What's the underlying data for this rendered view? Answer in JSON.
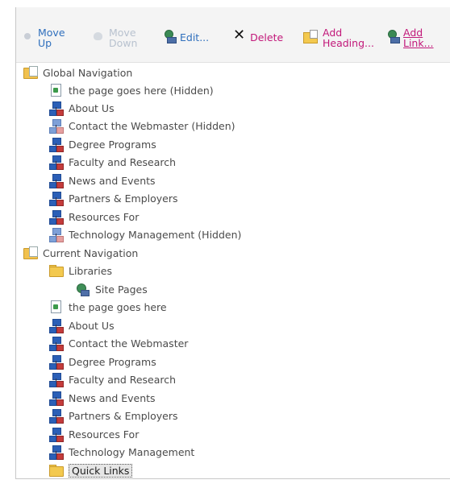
{
  "toolbar": {
    "move_up": [
      "Move",
      "Up"
    ],
    "move_down": [
      "Move",
      "Down"
    ],
    "edit": "Edit...",
    "delete": "Delete",
    "add_heading": [
      "Add",
      "Heading..."
    ],
    "add_link": [
      "Add",
      "Link..."
    ]
  },
  "tree": {
    "global": {
      "label": "Global Navigation",
      "items": [
        "the page goes here (Hidden)",
        "About Us",
        "Contact the Webmaster (Hidden)",
        "Degree Programs",
        "Faculty and Research",
        "News and Events",
        "Partners & Employers",
        "Resources For",
        "Technology Management (Hidden)"
      ]
    },
    "current": {
      "label": "Current Navigation",
      "libraries": "Libraries",
      "site_pages": "Site Pages",
      "items": [
        "the page goes here",
        "About Us",
        "Contact the Webmaster",
        "Degree Programs",
        "Faculty and Research",
        "News and Events",
        "Partners & Employers",
        "Resources For",
        "Technology Management"
      ],
      "quick_links": "Quick Links"
    }
  },
  "colors": {
    "toolbar_link": "#2f6fbd",
    "toolbar_action": "#c2187a",
    "toolbar_disabled": "#b8c2cf",
    "selected_bg": "#e6e6e6"
  },
  "icons": {
    "move_up": "arrow-up-icon",
    "move_down": "arrow-down-icon",
    "edit": "edit-icon",
    "delete": "delete-x-icon",
    "add_heading": "add-heading-icon",
    "add_link": "add-link-icon",
    "nav_root": "navigation-root-icon",
    "page": "page-icon",
    "link": "navigation-link-icon",
    "folder": "folder-icon",
    "site": "site-icon"
  }
}
